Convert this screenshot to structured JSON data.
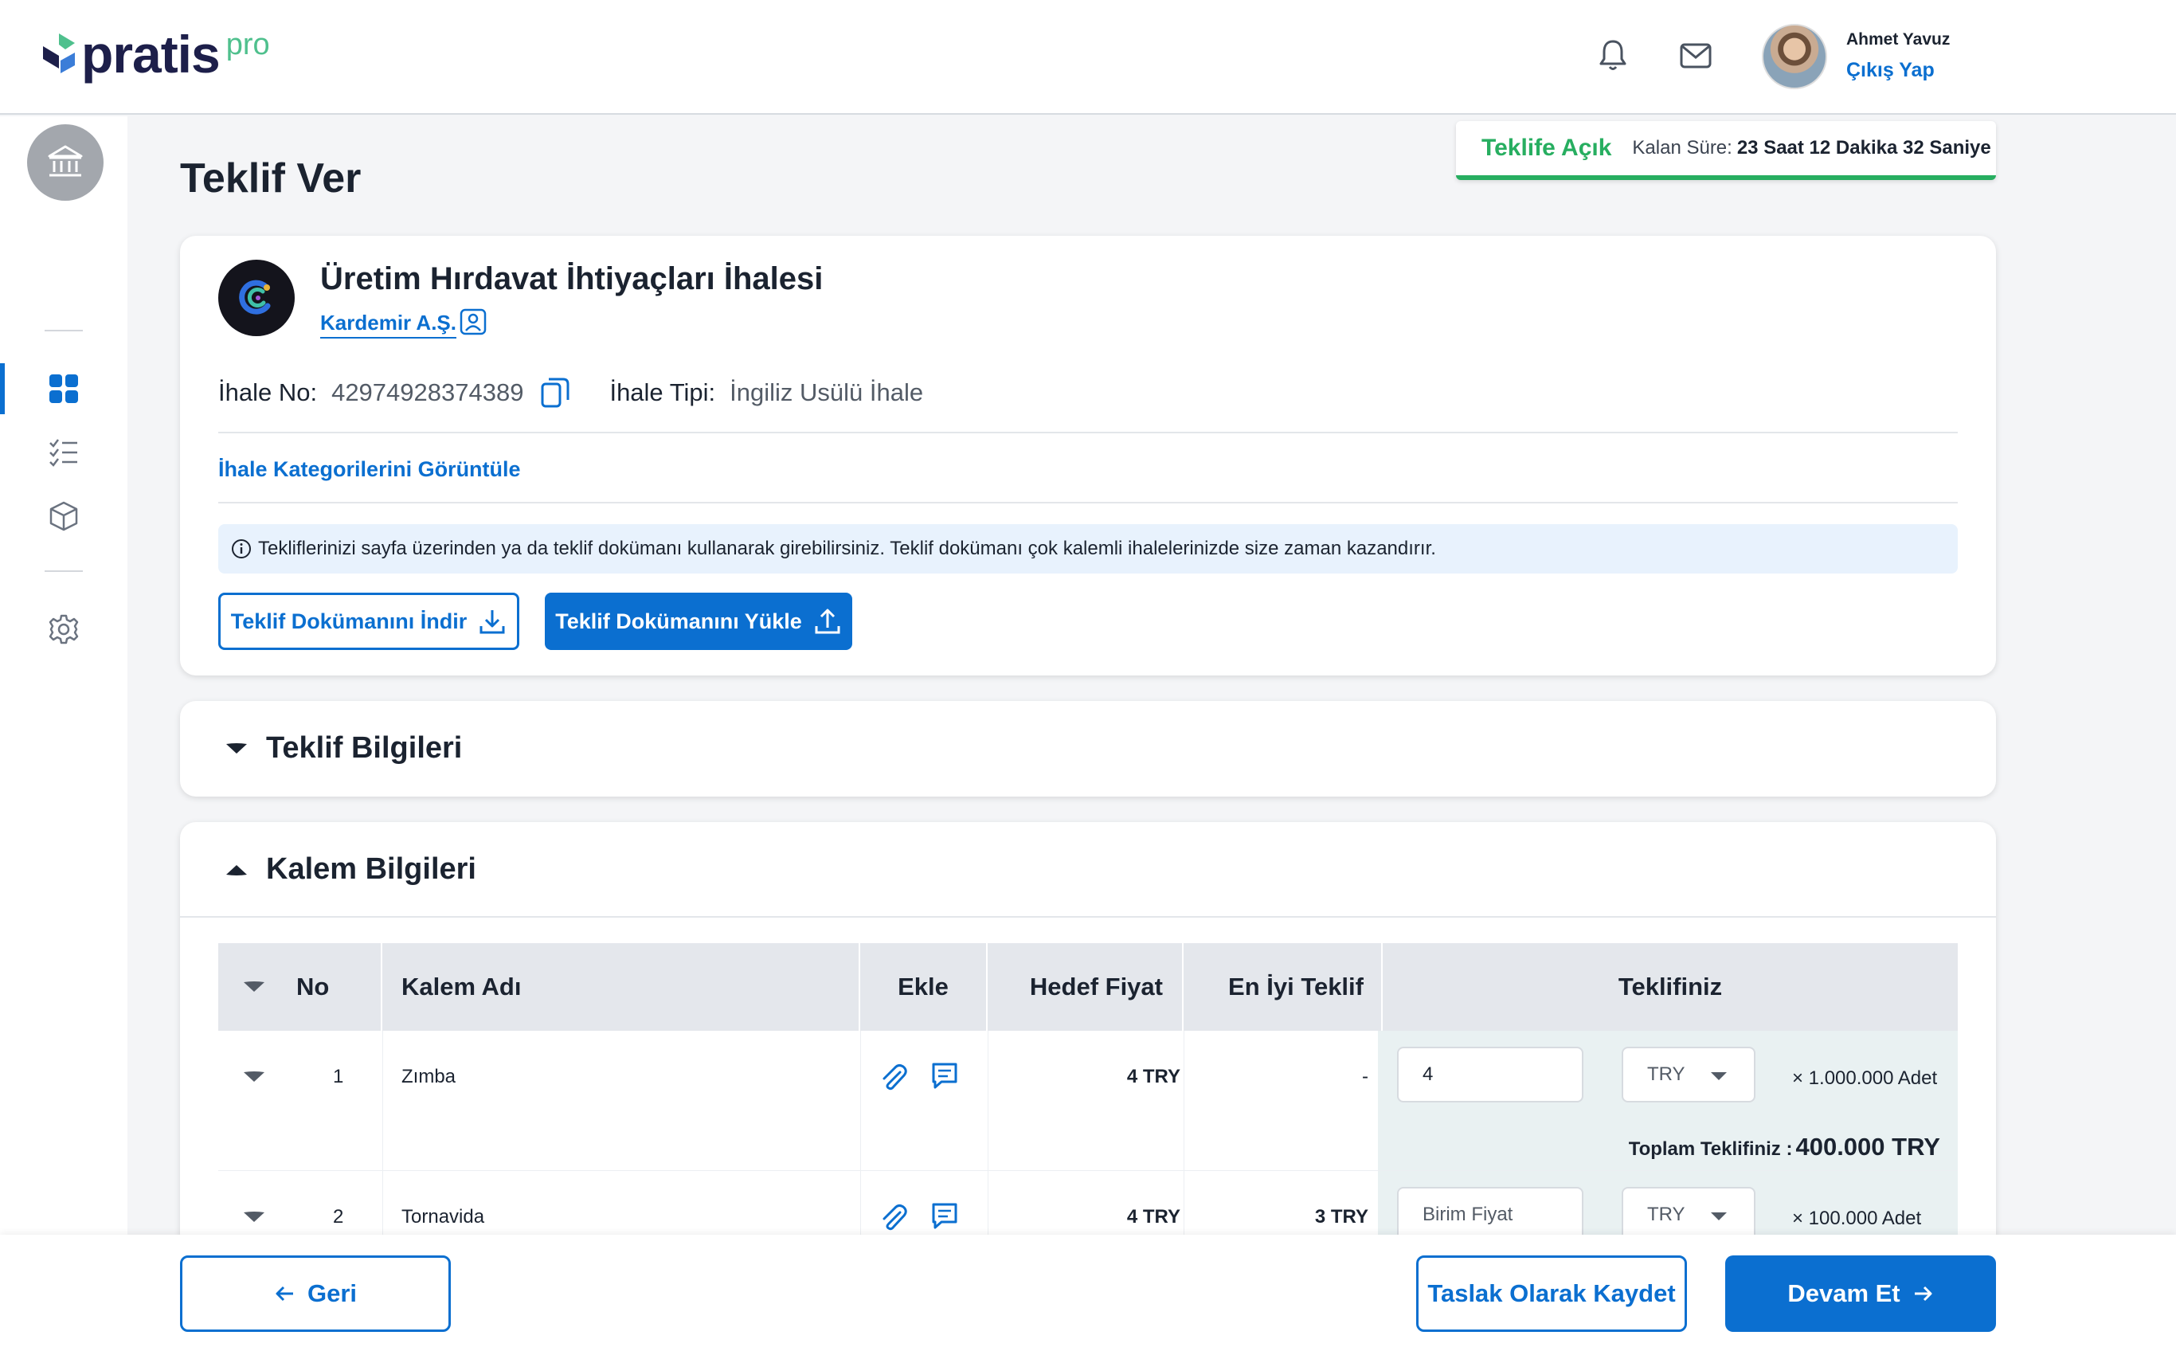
{
  "brand": {
    "logo_text": "pratis",
    "logo_suffix": "pro",
    "accent": "#0b6fd0",
    "success": "#27ae60"
  },
  "header": {
    "notification_icon": "bell-icon",
    "mail_icon": "mail-icon",
    "user_name": "Ahmet Yavuz",
    "logout_label": "Çıkış Yap"
  },
  "sidebar": {
    "items": [
      {
        "icon": "bank-icon"
      },
      {
        "icon": "dashboard-icon",
        "active": true
      },
      {
        "icon": "checklist-icon"
      },
      {
        "icon": "box-icon"
      },
      {
        "icon": "gear-icon"
      }
    ]
  },
  "page": {
    "title": "Teklif Ver"
  },
  "status": {
    "state": "Teklife Açık",
    "remaining_label": "Kalan Süre:",
    "remaining_value": "23 Saat 12 Dakika 32 Saniye"
  },
  "tender": {
    "title": "Üretim Hırdavat İhtiyaçları İhalesi",
    "company": "Kardemir A.Ş.",
    "no_label": "İhale No:",
    "no_value": "42974928374389",
    "type_label": "İhale Tipi:",
    "type_value": "İngiliz Usülü İhale",
    "categories_link": "İhale Kategorilerini Görüntüle",
    "notice": "Tekliflerinizi sayfa üzerinden ya da teklif dokümanı kullanarak girebilirsiniz. Teklif dokümanı çok kalemli ihalelerinizde size zaman kazandırır.",
    "download_btn": "Teklif Dokümanını İndir",
    "upload_btn": "Teklif Dokümanını Yükle"
  },
  "sections": {
    "offer_info": "Teklif Bilgileri",
    "item_info": "Kalem Bilgileri"
  },
  "table": {
    "headers": {
      "no": "No",
      "name": "Kalem Adı",
      "add": "Ekle",
      "target": "Hedef Fiyat",
      "best": "En İyi Teklif",
      "yours": "Teklifiniz"
    },
    "total_label": "Toplam Teklifiniz :",
    "rows": [
      {
        "no": "1",
        "name": "Zımba",
        "target": "4 TRY",
        "best": "-",
        "price_value": "4",
        "price_placeholder": "",
        "currency": "TRY",
        "qty": "× 1.000.000 Adet",
        "total": "400.000 TRY"
      },
      {
        "no": "2",
        "name": "Tornavida",
        "target": "4 TRY",
        "best": "3 TRY",
        "price_value": "",
        "price_placeholder": "Birim Fiyat",
        "currency": "TRY",
        "qty": "× 100.000 Adet"
      }
    ]
  },
  "footer": {
    "back": "Geri",
    "save_draft": "Taslak Olarak Kaydet",
    "continue": "Devam Et"
  }
}
